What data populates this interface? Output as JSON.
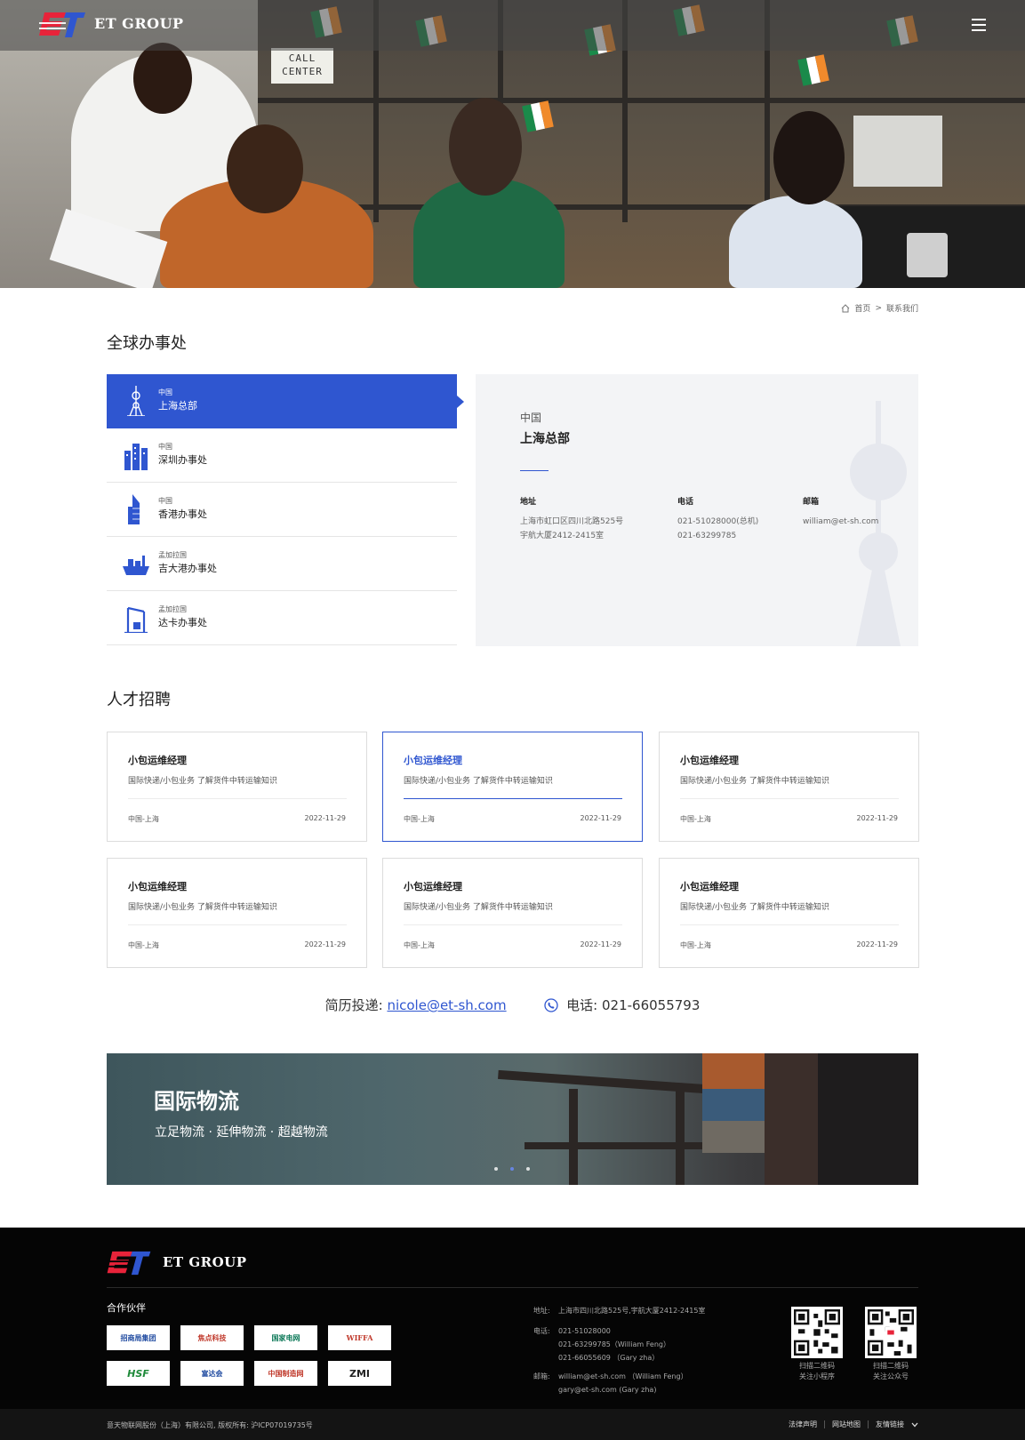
{
  "header": {
    "brand": "ET GROUP",
    "hero_sign": "CALL\nCENTER"
  },
  "breadcrumb": {
    "home": "首页",
    "separator": ">",
    "current": "联系我们"
  },
  "offices_section": {
    "title": "全球办事处",
    "items": [
      {
        "country": "中国",
        "name": "上海总部",
        "icon": "tower-icon",
        "active": true
      },
      {
        "country": "中国",
        "name": "深圳办事处",
        "icon": "skyscrapers-icon",
        "active": false
      },
      {
        "country": "中国",
        "name": "香港办事处",
        "icon": "building-icon",
        "active": false
      },
      {
        "country": "孟加拉国",
        "name": "吉大港办事处",
        "icon": "ship-icon",
        "active": false
      },
      {
        "country": "孟加拉国",
        "name": "达卡办事处",
        "icon": "crane-icon",
        "active": false
      }
    ],
    "detail": {
      "country": "中国",
      "name": "上海总部",
      "address_label": "地址",
      "address_line1": "上海市虹口区四川北路525号",
      "address_line2": "宇航大厦2412-2415室",
      "phone_label": "电话",
      "phone_line1": "021-51028000(总机)",
      "phone_line2": "021-63299785",
      "email_label": "邮箱",
      "email": "william@et-sh.com"
    }
  },
  "jobs_section": {
    "title": "人才招聘",
    "jobs": [
      {
        "title": "小包运维经理",
        "desc": "国际快递/小包业务 了解货件中转运输知识",
        "location": "中国-上海",
        "date": "2022-11-29"
      },
      {
        "title": "小包运维经理",
        "desc": "国际快递/小包业务 了解货件中转运输知识",
        "location": "中国-上海",
        "date": "2022-11-29"
      },
      {
        "title": "小包运维经理",
        "desc": "国际快递/小包业务 了解货件中转运输知识",
        "location": "中国-上海",
        "date": "2022-11-29"
      },
      {
        "title": "小包运维经理",
        "desc": "国际快递/小包业务 了解货件中转运输知识",
        "location": "中国-上海",
        "date": "2022-11-29"
      },
      {
        "title": "小包运维经理",
        "desc": "国际快递/小包业务 了解货件中转运输知识",
        "location": "中国-上海",
        "date": "2022-11-29"
      },
      {
        "title": "小包运维经理",
        "desc": "国际快递/小包业务 了解货件中转运输知识",
        "location": "中国-上海",
        "date": "2022-11-29"
      }
    ],
    "resume_label": "简历投递:",
    "resume_email": "nicole@et-sh.com",
    "phone_label": "电话: 021-66055793"
  },
  "banner": {
    "title": "国际物流",
    "subtitle": "立足物流 · 延伸物流 · 超越物流",
    "current_slide": 2,
    "slide_count": 3
  },
  "footer": {
    "brand": "ET GROUP",
    "partners_title": "合作伙伴",
    "partners": [
      "招商局集团",
      "焦点科技",
      "国家电网",
      "WIFFA",
      "HSF",
      "富达会",
      "中国制造网",
      "ZMI"
    ],
    "address_label": "地址:",
    "address": "上海市四川北路525号,宇航大厦2412-2415室",
    "phone_label": "电话:",
    "phones": [
      "021-51028000",
      "021-63299785（William Feng）",
      "021-66055609 （Gary zha）"
    ],
    "email_label": "邮箱:",
    "emails": [
      "william@et-sh.com （William Feng）",
      "gary@et-sh.com        (Gary zha)"
    ],
    "qr1_caption_1": "扫描二维码",
    "qr1_caption_2": "关注小程序",
    "qr2_caption_1": "扫描二维码",
    "qr2_caption_2": "关注公众号",
    "copyright": "意天物联网股份（上海）有限公司, 版权所有: 沪ICP07019735号",
    "links": [
      "法律声明",
      "网站地图",
      "友情链接"
    ]
  },
  "colors": {
    "accent": "#2f56d0",
    "footer_bg": "#050505",
    "detail_bg": "#f3f4f6"
  }
}
